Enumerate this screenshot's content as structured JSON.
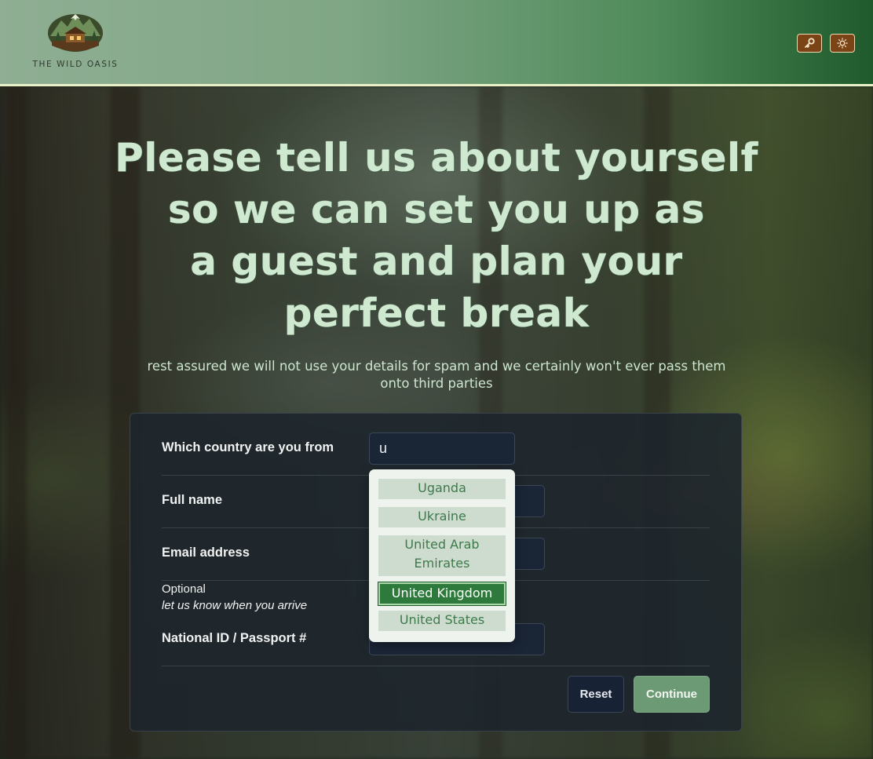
{
  "header": {
    "brand": "THE WILD OASIS",
    "buttons": [
      {
        "icon": "key-icon",
        "color": "#7b4417"
      },
      {
        "icon": "sun-icon",
        "color": "#7b4417"
      }
    ]
  },
  "hero": {
    "lines": [
      "Please tell us about yourself",
      "so we can set you up as",
      "a guest and plan your",
      "perfect break"
    ],
    "subtitle": "rest assured we will not use your details for spam and we certainly won't ever pass them onto third parties"
  },
  "form": {
    "country_label": "Which country are you from",
    "country_value": "u",
    "fullname_label": "Full name",
    "email_label": "Email address",
    "optional_label": "Optional",
    "optional_hint": "let us know when you arrive",
    "national_id_label": "National ID / Passport #",
    "reset_label": "Reset",
    "continue_label": "Continue"
  },
  "dropdown": {
    "options": [
      "Uganda",
      "Ukraine",
      "United Arab Emirates",
      "United Kingdom",
      "United States"
    ],
    "selected": "United Kingdom"
  },
  "colors": {
    "accent": "#6b9a74",
    "selected_option": "#2e7a3c",
    "header_button": "#7b4417"
  }
}
